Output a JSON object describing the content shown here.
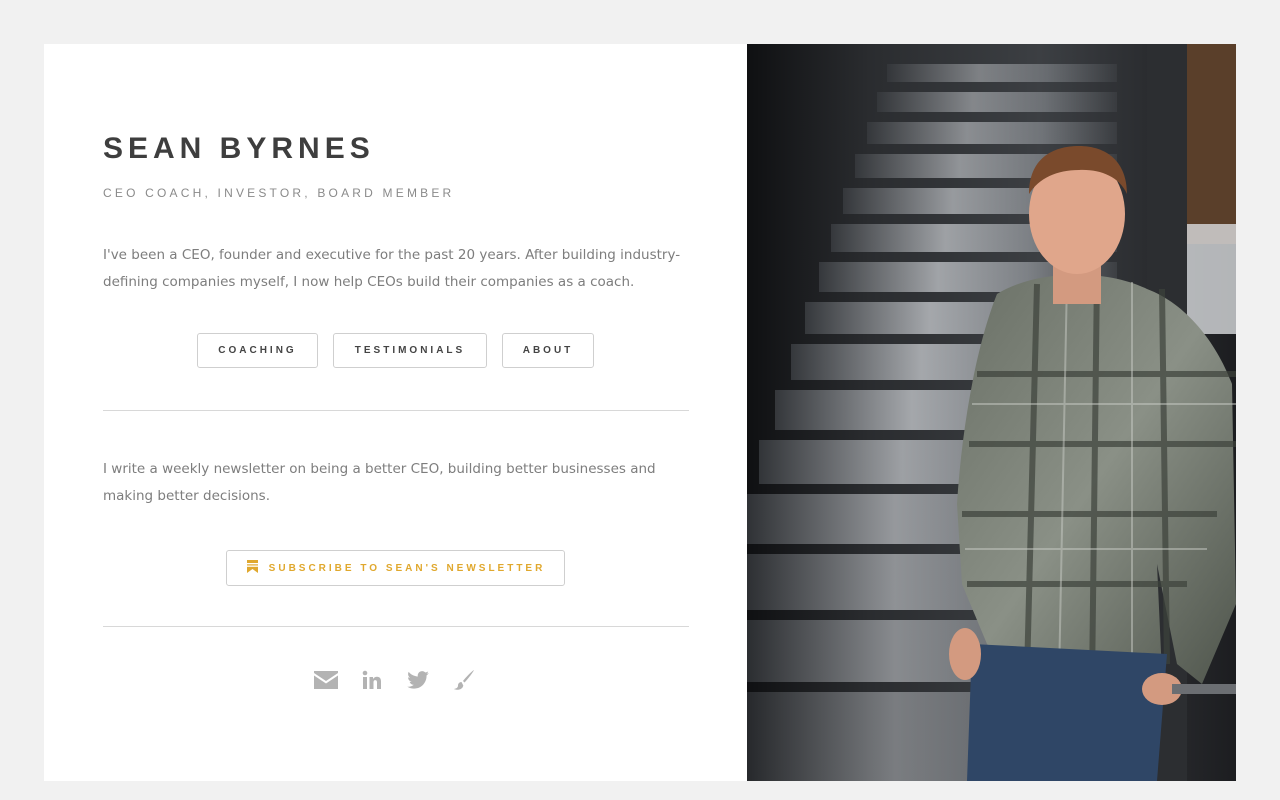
{
  "profile": {
    "name": "SEAN BYRNES",
    "tagline": "CEO COACH, INVESTOR, BOARD MEMBER",
    "intro": "I've been a CEO, founder and executive for the past 20 years. After building industry-defining companies myself, I now help CEOs build their companies as a coach."
  },
  "nav": {
    "items": [
      {
        "label": "COACHING"
      },
      {
        "label": "TESTIMONIALS"
      },
      {
        "label": "ABOUT"
      }
    ]
  },
  "newsletter": {
    "text": "I write a weekly newsletter on being a better CEO, building better businesses and making better decisions.",
    "button_label": "SUBSCRIBE TO SEAN'S NEWSLETTER",
    "button_icon": "bookmark-icon"
  },
  "social": {
    "icons": [
      "email-icon",
      "linkedin-icon",
      "twitter-icon",
      "paintbrush-icon"
    ]
  },
  "colors": {
    "background": "#f1f1f1",
    "card": "#ffffff",
    "accent": "#e0a82e",
    "text": "#7d7d7d",
    "heading": "#3e3e3e",
    "icon": "#b3b3b3"
  }
}
